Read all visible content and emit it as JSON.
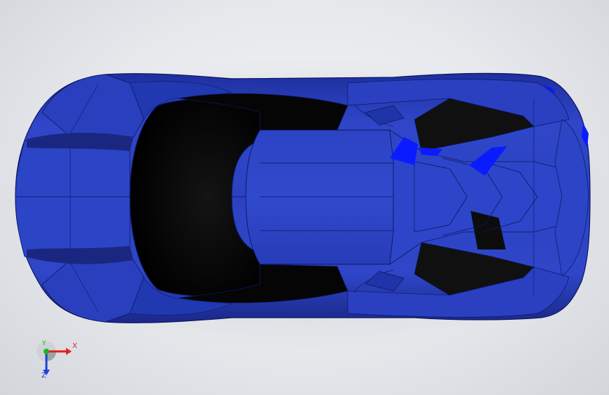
{
  "viewport": {
    "background_center": "#f4f5f7",
    "background_edge": "#d2d5da"
  },
  "model": {
    "name_icon": "car-body-top-view",
    "body_color": "#2a3fc4",
    "body_shadow": "#1a2a94",
    "highlight_color": "#0a1cff",
    "glass_color": "#0a0a0a"
  },
  "triad": {
    "x_label": "X",
    "y_label": "Y",
    "z_label": "Z",
    "x_color": "#e02020",
    "y_color": "#19b819",
    "z_color": "#1f3fd6"
  }
}
